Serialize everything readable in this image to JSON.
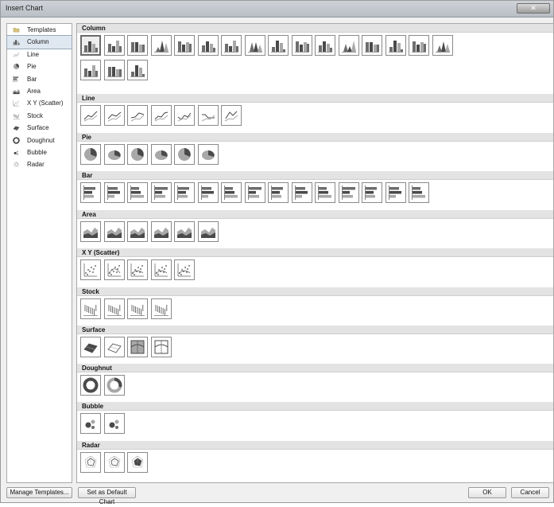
{
  "window": {
    "title": "Insert Chart"
  },
  "sidebar": {
    "items": [
      {
        "label": "Templates",
        "icon": "folder-icon"
      },
      {
        "label": "Column",
        "icon": "column-chart-icon"
      },
      {
        "label": "Line",
        "icon": "line-chart-icon"
      },
      {
        "label": "Pie",
        "icon": "pie-chart-icon"
      },
      {
        "label": "Bar",
        "icon": "bar-chart-icon"
      },
      {
        "label": "Area",
        "icon": "area-chart-icon"
      },
      {
        "label": "X Y (Scatter)",
        "icon": "scatter-chart-icon"
      },
      {
        "label": "Stock",
        "icon": "stock-chart-icon"
      },
      {
        "label": "Surface",
        "icon": "surface-chart-icon"
      },
      {
        "label": "Doughnut",
        "icon": "doughnut-chart-icon"
      },
      {
        "label": "Bubble",
        "icon": "bubble-chart-icon"
      },
      {
        "label": "Radar",
        "icon": "radar-chart-icon"
      }
    ],
    "selected_index": 1
  },
  "sections": [
    {
      "label": "Column",
      "icon": "column",
      "count": 19
    },
    {
      "label": "Line",
      "icon": "line",
      "count": 7
    },
    {
      "label": "Pie",
      "icon": "pie",
      "count": 6
    },
    {
      "label": "Bar",
      "icon": "bar",
      "count": 15
    },
    {
      "label": "Area",
      "icon": "area",
      "count": 6
    },
    {
      "label": "X Y (Scatter)",
      "icon": "scatter",
      "count": 5
    },
    {
      "label": "Stock",
      "icon": "stock",
      "count": 4
    },
    {
      "label": "Surface",
      "icon": "surface",
      "count": 4
    },
    {
      "label": "Doughnut",
      "icon": "doughnut",
      "count": 2
    },
    {
      "label": "Bubble",
      "icon": "bubble",
      "count": 2
    },
    {
      "label": "Radar",
      "icon": "radar",
      "count": 3
    }
  ],
  "footer": {
    "manage_templates_label": "Manage Templates...",
    "set_default_label": "Set as Default Chart",
    "ok_label": "OK",
    "cancel_label": "Cancel"
  },
  "colors": {
    "accent": "#4d4d4d",
    "selection": "#dfe7f0",
    "header": "#e3e3e3"
  }
}
